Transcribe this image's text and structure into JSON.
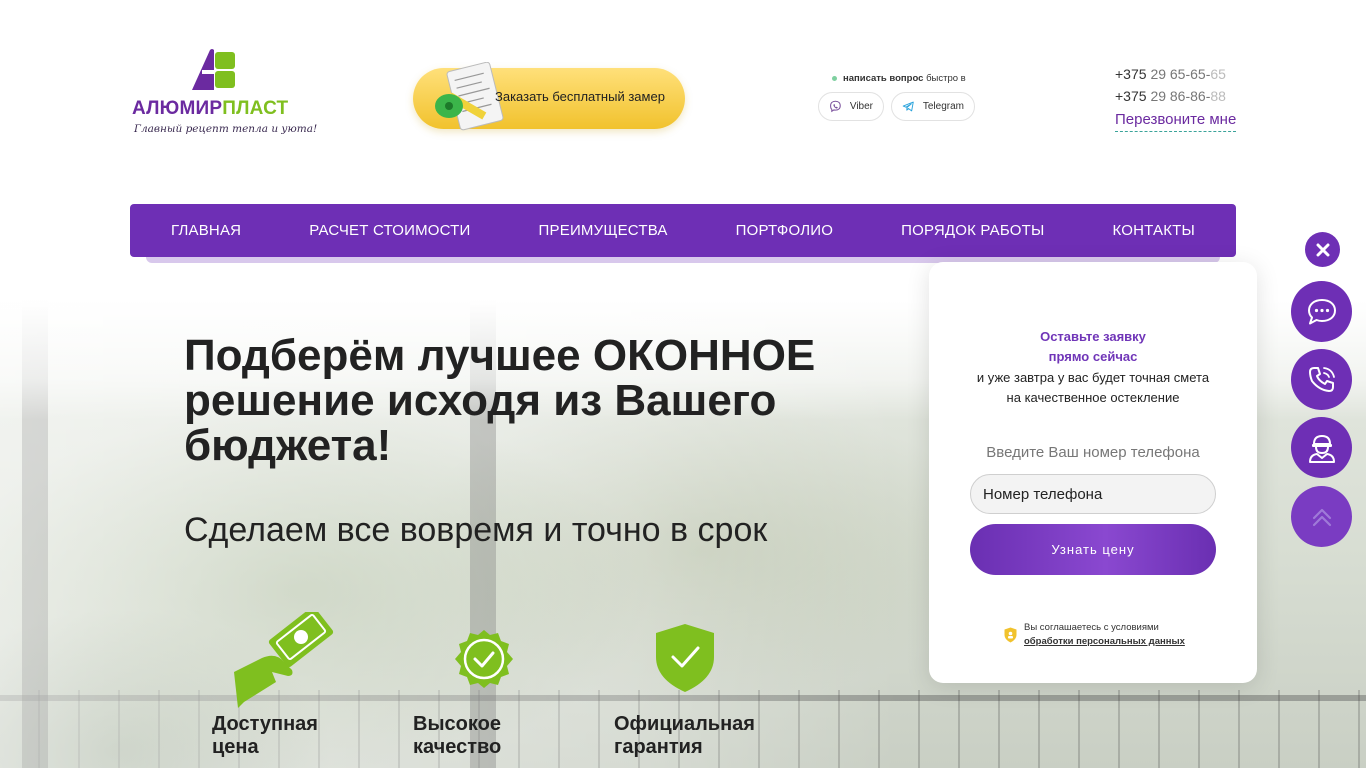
{
  "header": {
    "logo": {
      "name_part1": "АЛЮМИР",
      "name_part2": "ПЛАСТ",
      "slogan": "Главный рецепт тепла и уюта!"
    },
    "measure_button_label": "Заказать бесплатный замер",
    "messengers": {
      "prompt_bold": "написать вопрос",
      "prompt_rest": "быстро в",
      "viber_label": "Viber",
      "telegram_label": "Telegram"
    },
    "phones": [
      {
        "code": "+375",
        "number": "29 65-65-",
        "tail": "65"
      },
      {
        "code": "+375",
        "number": "29 86-86-",
        "tail": "88"
      }
    ],
    "callback_label": "Перезвоните мне"
  },
  "nav": {
    "items": [
      "ГЛАВНАЯ",
      "РАСЧЕТ СТОИМОСТИ",
      "ПРЕИМУЩЕСТВА",
      "ПОРТФОЛИО",
      "ПОРЯДОК РАБОТЫ",
      "КОНТАКТЫ"
    ]
  },
  "hero": {
    "title_line1": "Подберём лучшее ОКОННОЕ",
    "title_line2": "решение исходя из Вашего",
    "title_line3": "бюджета!",
    "subtitle": "Сделаем все вовремя и точно в срок",
    "features": [
      {
        "line1": "Доступная",
        "line2": "цена",
        "icon": "money-hand-icon"
      },
      {
        "line1": "Высокое",
        "line2": "качество",
        "icon": "quality-check-badge-icon"
      },
      {
        "line1": "Официальная",
        "line2": "гарантия",
        "icon": "guarantee-shield-icon"
      }
    ]
  },
  "form": {
    "heading_line1": "Оставьте заявку",
    "heading_line2": "прямо сейчас",
    "text_line1": "и уже завтра у вас будет точная смета",
    "text_line2": "на качественное остекление",
    "phone_label": "Введите Ваш номер телефона",
    "phone_placeholder": "Номер телефона",
    "submit_label": "Узнать цену",
    "agree_text": "Вы соглашаетесь с условиями",
    "agree_link": "обработки персональных данных"
  },
  "widgets": {
    "icons": [
      "close-icon",
      "chat-icon",
      "phone-call-icon",
      "worker-icon",
      "scroll-up-icon"
    ]
  },
  "colors": {
    "brand_purple": "#6e2fb5",
    "brand_green": "#7fbf1f",
    "button_yellow": "#f1c22d"
  }
}
